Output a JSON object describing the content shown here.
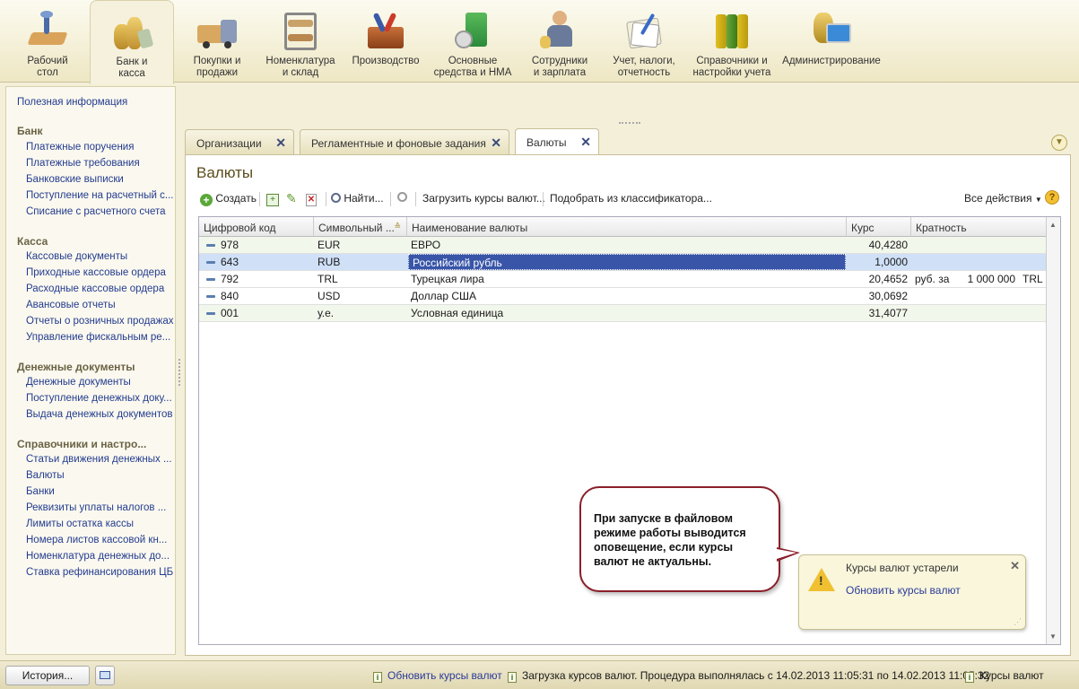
{
  "sections": [
    {
      "label": "Рабочий\nстол",
      "icon": "desk-icon"
    },
    {
      "label": "Банк и\nкасса",
      "icon": "coins-icon"
    },
    {
      "label": "Покупки и\nпродажи",
      "icon": "truck-icon"
    },
    {
      "label": "Номенклатура\nи склад",
      "icon": "warehouse-shelf-icon"
    },
    {
      "label": "Производство",
      "icon": "toolbox-icon"
    },
    {
      "label": "Основные\nсредства и НМА",
      "icon": "assets-icon"
    },
    {
      "label": "Сотрудники\nи зарплата",
      "icon": "employee-icon"
    },
    {
      "label": "Учет, налоги,\nотчетность",
      "icon": "report-icon"
    },
    {
      "label": "Справочники и\nнастройки учета",
      "icon": "binders-icon"
    },
    {
      "label": "Администрирование",
      "icon": "admin-icon"
    }
  ],
  "sidebar": {
    "top_item": "Полезная информация",
    "groups": [
      {
        "title": "Банк",
        "items": [
          "Платежные поручения",
          "Платежные требования",
          "Банковские выписки",
          "Поступление на расчетный с...",
          "Списание с расчетного счета"
        ]
      },
      {
        "title": "Касса",
        "items": [
          "Кассовые документы",
          "Приходные кассовые ордера",
          "Расходные кассовые ордера",
          "Авансовые отчеты",
          "Отчеты о розничных продажах",
          "Управление фискальным ре..."
        ]
      },
      {
        "title": "Денежные документы",
        "items": [
          "Денежные документы",
          "Поступление денежных доку...",
          "Выдача денежных документов"
        ]
      },
      {
        "title": "Справочники и настро...",
        "items": [
          "Статьи движения денежных ...",
          "Валюты",
          "Банки",
          "Реквизиты уплаты налогов ...",
          "Лимиты остатка кассы",
          "Номера листов кассовой кн...",
          "Номенклатура денежных до...",
          "Ставка рефинансирования ЦБ"
        ]
      }
    ]
  },
  "tabs": [
    {
      "label": "Организации"
    },
    {
      "label": "Регламентные и фоновые задания"
    },
    {
      "label": "Валюты"
    }
  ],
  "page_title": "Валюты",
  "toolbar": {
    "create": "Создать",
    "find": "Найти...",
    "load_rates": "Загрузить курсы валют...",
    "pick_classifier": "Подобрать из классификатора...",
    "all_actions": "Все действия",
    "help": "?"
  },
  "table": {
    "headers": [
      "Цифровой код",
      "Символьный ...",
      "Наименование валюты",
      "Курс",
      "Кратность"
    ],
    "rows": [
      {
        "code": "978",
        "sym": "EUR",
        "name": "ЕВРО",
        "rate": "40,4280",
        "mult_label": "",
        "mult": "",
        "mult_cur": ""
      },
      {
        "code": "643",
        "sym": "RUB",
        "name": "Российский рубль",
        "rate": "1,0000",
        "mult_label": "",
        "mult": "",
        "mult_cur": ""
      },
      {
        "code": "792",
        "sym": "TRL",
        "name": "Турецкая лира",
        "rate": "20,4652",
        "mult_label": "руб. за",
        "mult": "1 000 000",
        "mult_cur": "TRL"
      },
      {
        "code": "840",
        "sym": "USD",
        "name": "Доллар США",
        "rate": "30,0692",
        "mult_label": "",
        "mult": "",
        "mult_cur": ""
      },
      {
        "code": "001",
        "sym": "у.е.",
        "name": "Условная единица",
        "rate": "31,4077",
        "mult_label": "",
        "mult": "",
        "mult_cur": ""
      }
    ]
  },
  "callout": "При запуске в файловом режиме работы выводится оповещение, если курсы валют не актуальны.",
  "notification": {
    "title": "Курсы валют устарели",
    "link": "Обновить курсы валют"
  },
  "statusbar": {
    "history": "История...",
    "update_link": "Обновить курсы валют",
    "task_msg": "Загрузка курсов валют. Процедура выполнялась с 14.02.2013 11:05:31 по 14.02.2013 11:05:32",
    "rates": "Курсы валют"
  }
}
